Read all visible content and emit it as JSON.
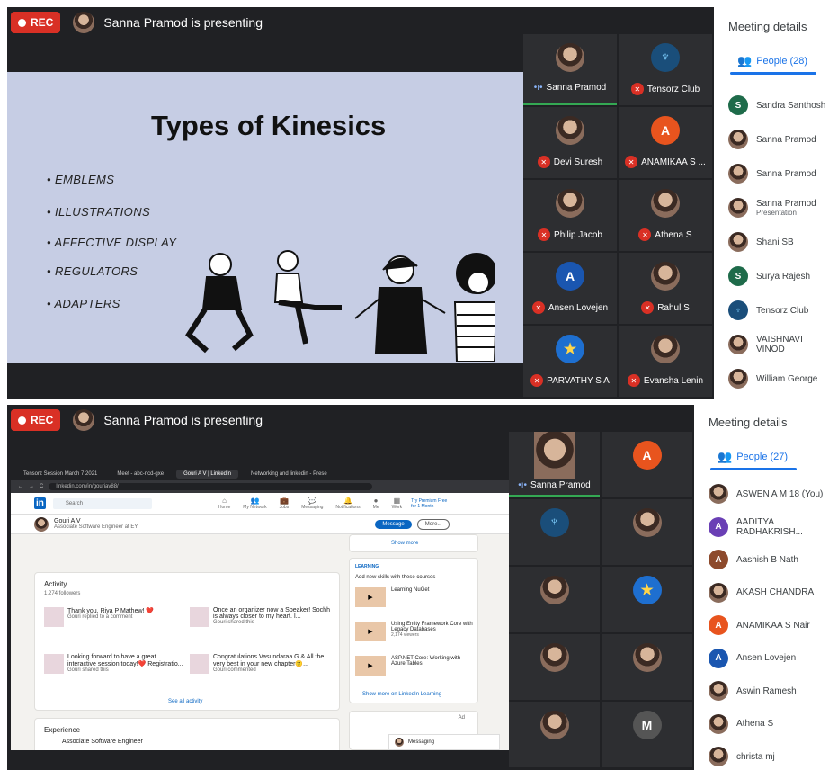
{
  "top": {
    "rec_label": "REC",
    "presenting": "Sanna Pramod is presenting",
    "slide": {
      "title": "Types of Kinesics",
      "bullets": [
        "EMBLEMS",
        "ILLUSTRATIONS",
        "AFFECTIVE DISPLAY",
        "REGULATORS",
        "ADAPTERS"
      ]
    },
    "tiles": [
      {
        "name": "Sanna Pramod",
        "avatar": "photo",
        "speaking": true
      },
      {
        "name": "Tensorz Club",
        "avatar": "logo",
        "muted": true
      },
      {
        "name": "Devi Suresh",
        "avatar": "photo",
        "muted": true
      },
      {
        "name": "ANAMIKAA S ...",
        "avatar": "A",
        "color": "#e8541e",
        "muted": true
      },
      {
        "name": "Philip Jacob",
        "avatar": "photo",
        "muted": true
      },
      {
        "name": "Athena S",
        "avatar": "photo",
        "muted": true
      },
      {
        "name": "Ansen Lovejen",
        "avatar": "A",
        "color": "#1a56b0",
        "muted": true
      },
      {
        "name": "Rahul S",
        "avatar": "photo",
        "muted": true
      },
      {
        "name": "PARVATHY S A",
        "avatar": "star",
        "muted": true
      },
      {
        "name": "Evansha Lenin",
        "avatar": "photo",
        "muted": true
      }
    ],
    "panel": {
      "title": "Meeting details",
      "people_tab": "People (28)",
      "people": [
        {
          "name": "Sandra Santhosh",
          "avatar": "S",
          "color": "#1e6b4a"
        },
        {
          "name": "Sanna Pramod",
          "avatar": "photo"
        },
        {
          "name": "Sanna Pramod",
          "avatar": "photo"
        },
        {
          "name": "Sanna Pramod",
          "sub": "Presentation",
          "avatar": "photo"
        },
        {
          "name": "Shani SB",
          "avatar": "photo"
        },
        {
          "name": "Surya Rajesh",
          "avatar": "S",
          "color": "#1e6b4a"
        },
        {
          "name": "Tensorz Club",
          "avatar": "logo"
        },
        {
          "name": "VAISHNAVI VINOD",
          "avatar": "photo"
        },
        {
          "name": "William George",
          "avatar": "photo"
        }
      ]
    }
  },
  "bottom": {
    "rec_label": "REC",
    "presenting": "Sanna Pramod is presenting",
    "browser": {
      "tabs": [
        "Tensorz Session March 7 2021",
        "Meet - abc-ncd-gxe",
        "Gouri A V | LinkedIn",
        "Networking and linkedin - Prese"
      ],
      "url": "linkedin.com/in/gouriav88/",
      "search_placeholder": "Search",
      "nav": [
        "Home",
        "My Network",
        "Jobs",
        "Messaging",
        "Notifications",
        "Me",
        "Work"
      ],
      "premium": "Try Premium Free for 1 Month",
      "profile_name": "Gouri A V",
      "profile_title": "Associate Software Engineer at EY",
      "message_btn": "Message",
      "more_btn": "More...",
      "activity_title": "Activity",
      "followers": "1,274 followers",
      "posts": [
        {
          "text": "Thank you, Riya P Mathew! ❤️",
          "meta": "Gouri replied to a comment"
        },
        {
          "text": "Once an organizer now a Speaker! Sochh is always closer to my heart. I...",
          "meta": "Gouri shared this"
        },
        {
          "text": "Looking forward to have a great interactive session today!❤️ Registratio...",
          "meta": "Gouri shared this"
        },
        {
          "text": "Congratulations Vasundaraa G & All the very best in your new chapter🙂...",
          "meta": "Gouri commented"
        }
      ],
      "see_all": "See all activity",
      "experience_title": "Experience",
      "experience_item": "Associate Software Engineer",
      "show_more": "Show more",
      "learning_badge": "LEARNING",
      "learning_heading": "Add new skills with these courses",
      "courses": [
        {
          "title": "Learning NuGet"
        },
        {
          "title": "Using Entity Framework Core with Legacy Databases",
          "meta": "2,174 viewers"
        },
        {
          "title": "ASP.NET Core: Working with Azure Tables"
        }
      ],
      "show_learning": "Show more on LinkedIn Learning",
      "ad_label": "Ad",
      "messaging": "Messaging"
    },
    "tiles": [
      {
        "name": "Sanna Pramod",
        "avatar": "video",
        "speaking": true
      },
      {
        "name": "",
        "avatar": "A",
        "color": "#e8541e"
      },
      {
        "name": "",
        "avatar": "logo"
      },
      {
        "name": "",
        "avatar": "photo"
      },
      {
        "name": "",
        "avatar": "photo"
      },
      {
        "name": "",
        "avatar": "star"
      },
      {
        "name": "",
        "avatar": "photo"
      },
      {
        "name": "",
        "avatar": "photo"
      },
      {
        "name": "",
        "avatar": "photo"
      },
      {
        "name": "",
        "avatar": "M"
      }
    ],
    "panel": {
      "title": "Meeting details",
      "people_tab": "People (27)",
      "people": [
        {
          "name": "ASWEN A M 18 (You)",
          "avatar": "photo"
        },
        {
          "name": "AADITYA RADHAKRISH...",
          "avatar": "A",
          "color": "#6a3fb5"
        },
        {
          "name": "Aashish B Nath",
          "avatar": "A",
          "color": "#8d4a2c"
        },
        {
          "name": "AKASH CHANDRA",
          "avatar": "photo"
        },
        {
          "name": "ANAMIKAA S Nair",
          "avatar": "A",
          "color": "#e8541e"
        },
        {
          "name": "Ansen Lovejen",
          "avatar": "A",
          "color": "#1a56b0"
        },
        {
          "name": "Aswin Ramesh",
          "avatar": "photo"
        },
        {
          "name": "Athena S",
          "avatar": "photo"
        },
        {
          "name": "christa mj",
          "avatar": "photo"
        }
      ]
    }
  }
}
